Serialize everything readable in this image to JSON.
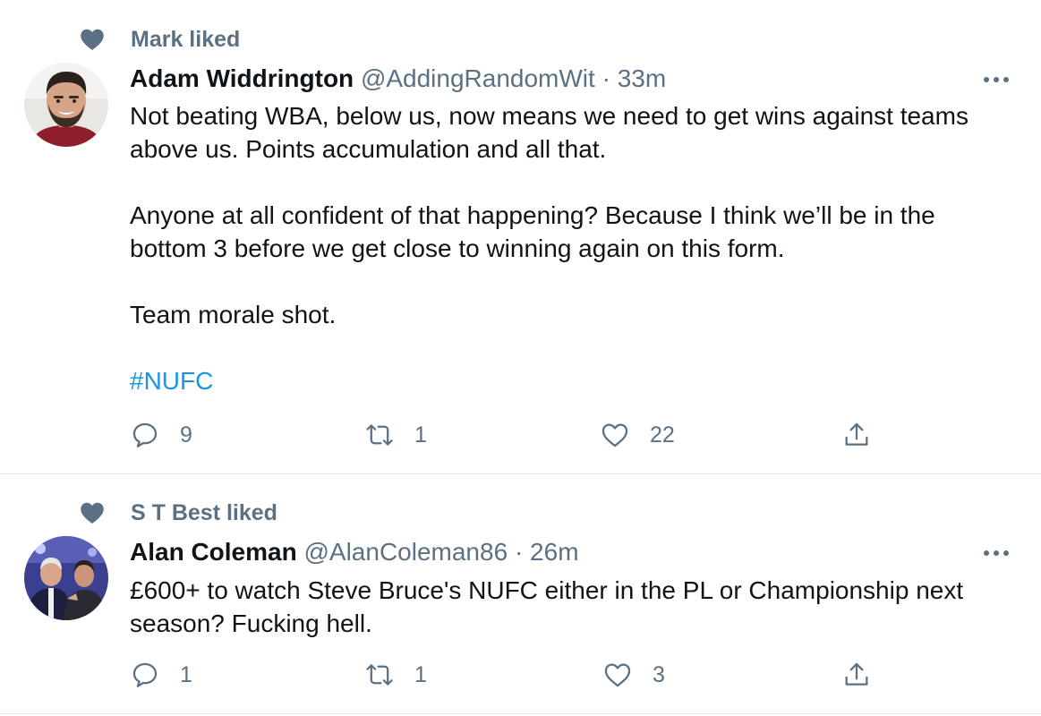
{
  "tweets": [
    {
      "social_context": "Mark liked",
      "author_name": "Adam Widdrington",
      "author_handle": "@AddingRandomWit",
      "separator": "·",
      "time": "33m",
      "text_paragraphs": [
        "Not beating WBA, below us, now means we need to get wins against teams above us. Points accumulation and all that.",
        "Anyone at all confident of that happening? Because I think we’ll be in the bottom 3 before we get close to winning again on this form.",
        "Team morale shot."
      ],
      "hashtag": "#NUFC",
      "reply_count": "9",
      "retweet_count": "1",
      "like_count": "22"
    },
    {
      "social_context": "S T Best liked",
      "author_name": "Alan Coleman",
      "author_handle": "@AlanColeman86",
      "separator": "·",
      "time": "26m",
      "text_paragraphs": [
        "£600+ to watch Steve Bruce's NUFC either in the PL or Championship next season? Fucking hell."
      ],
      "reply_count": "1",
      "retweet_count": "1",
      "like_count": "3"
    }
  ],
  "colors": {
    "text_primary": "#0f1419",
    "text_secondary": "#5b7083",
    "hashtag": "#1b95e0",
    "divider": "#e1e8ed"
  },
  "icons": [
    "heart-filled-icon",
    "more-icon",
    "reply-icon",
    "retweet-icon",
    "like-icon",
    "share-icon"
  ]
}
